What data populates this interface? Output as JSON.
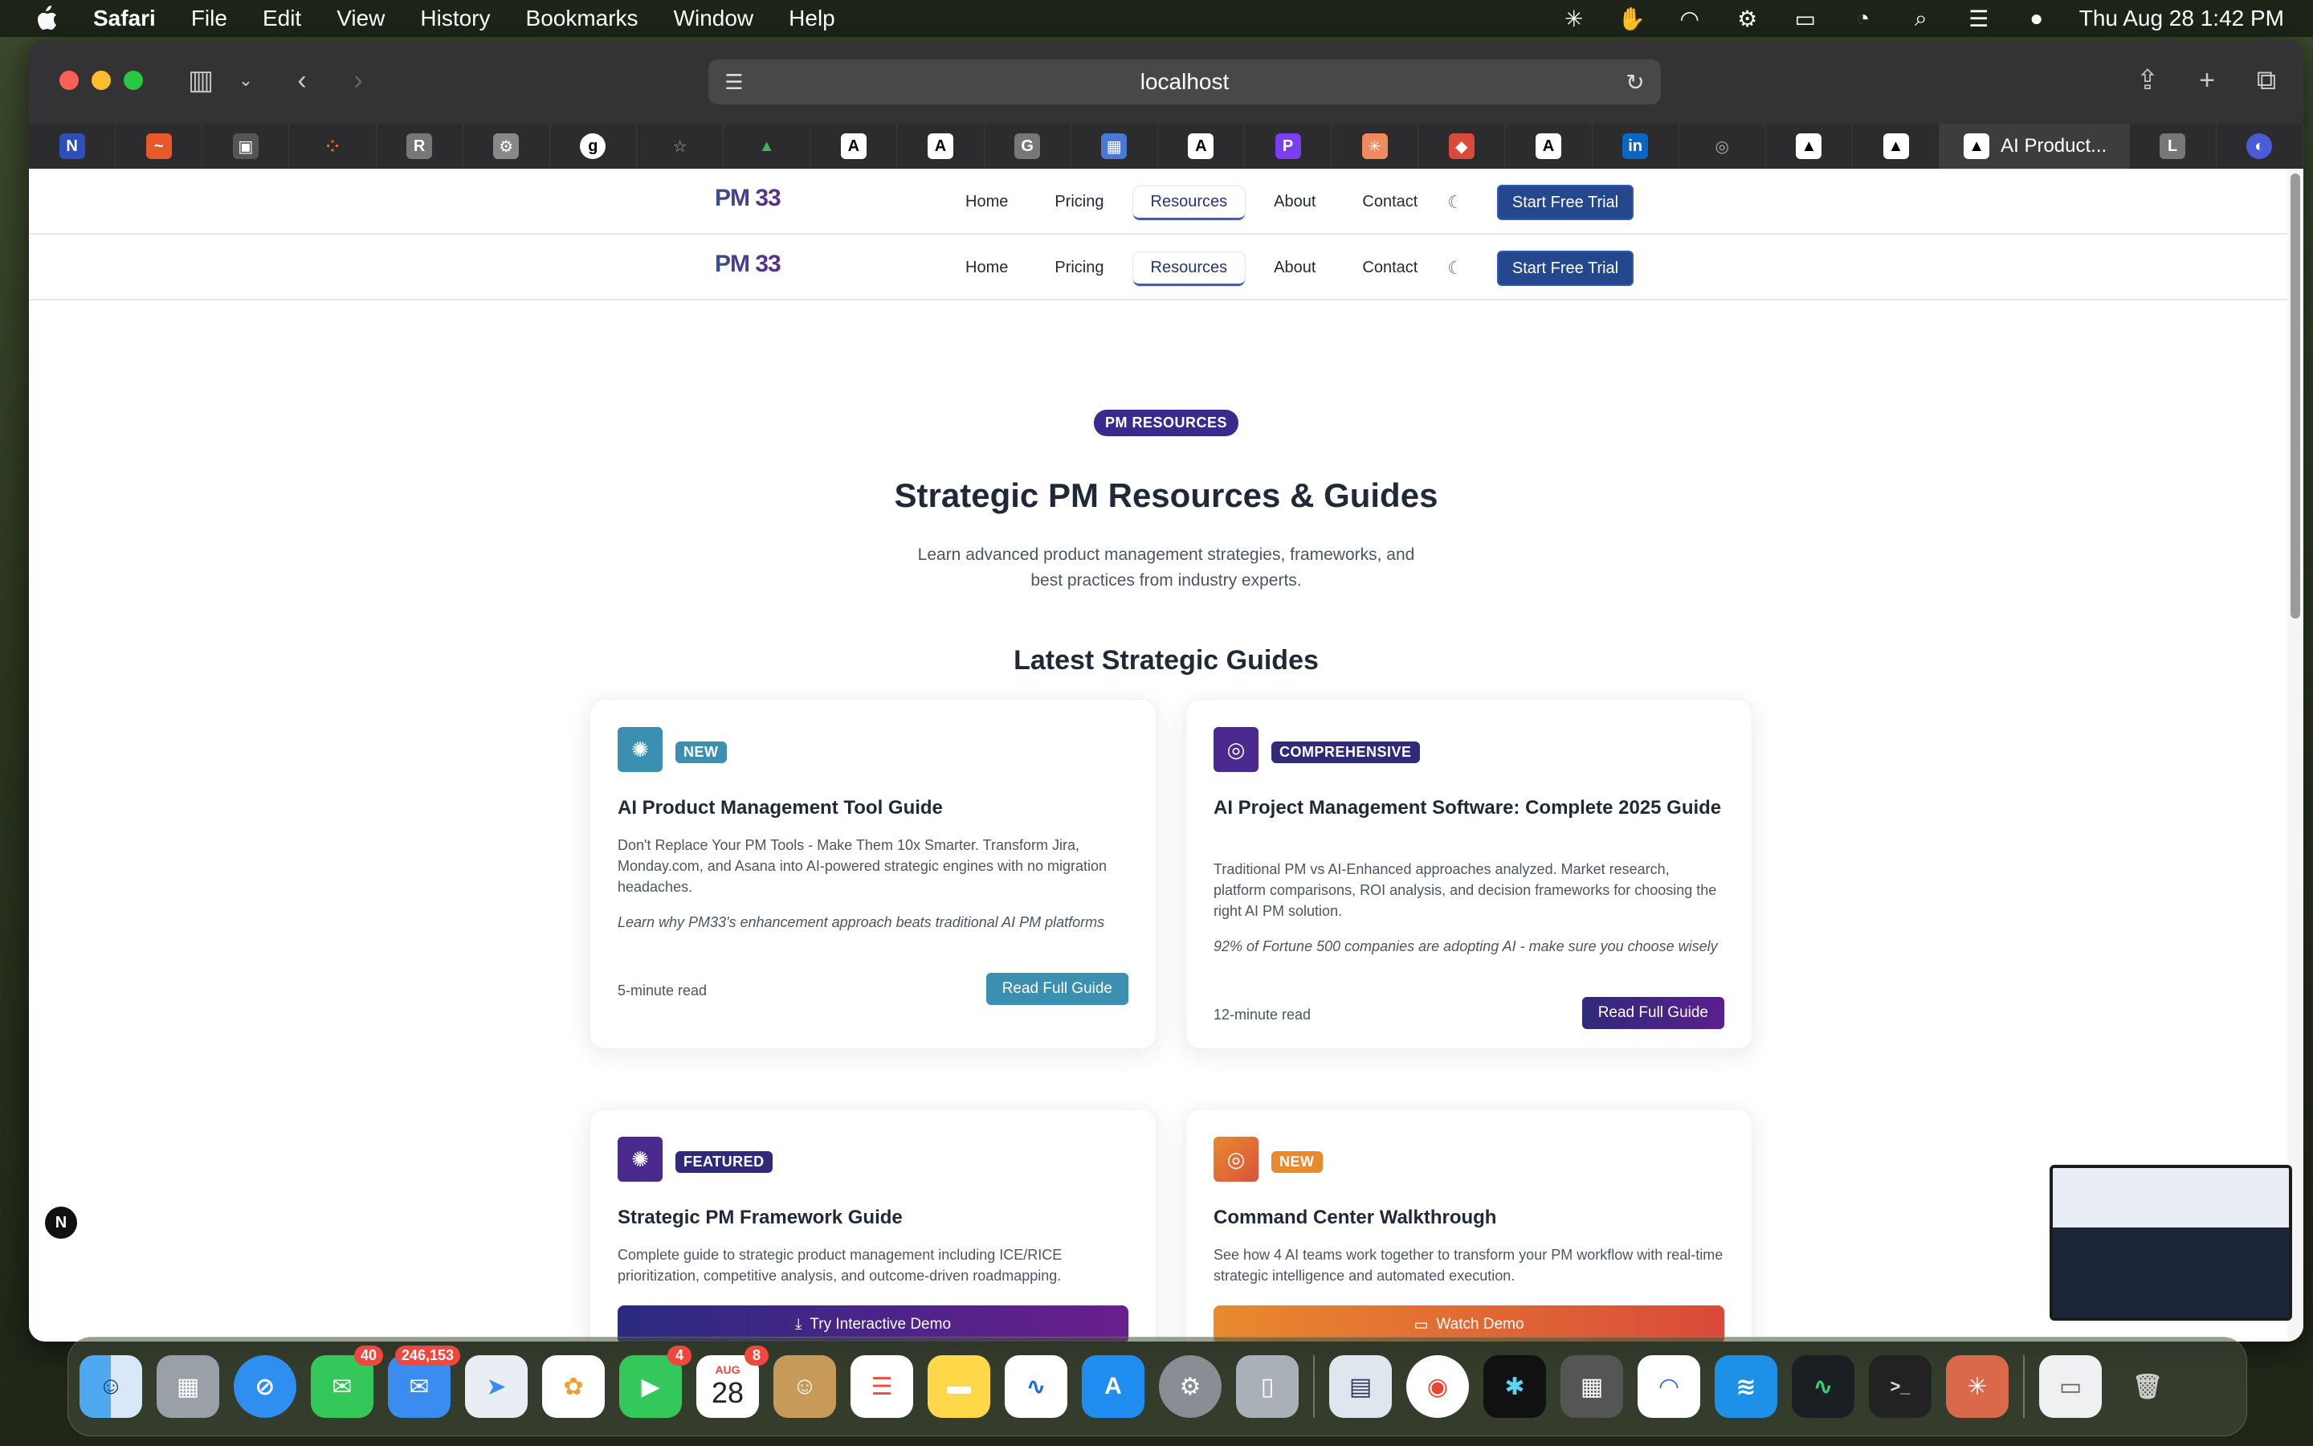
{
  "menubar": {
    "app_name": "Safari",
    "items": [
      "File",
      "Edit",
      "View",
      "History",
      "Bookmarks",
      "Window",
      "Help"
    ],
    "clock": "Thu Aug 28  1:42 PM"
  },
  "browser": {
    "url": "localhost",
    "active_tab_title": "AI Product..."
  },
  "site": {
    "logo": "PM 33",
    "nav": [
      "Home",
      "Pricing",
      "Resources",
      "About",
      "Contact"
    ],
    "active_nav": "Resources",
    "cta": "Start Free Trial"
  },
  "hero": {
    "badge": "PM RESOURCES",
    "title": "Strategic PM Resources & Guides",
    "subtitle": "Learn advanced product management strategies, frameworks, and best practices from industry experts.",
    "section_title": "Latest Strategic Guides"
  },
  "cards": [
    {
      "badge": "NEW",
      "title": "AI Product Management Tool Guide",
      "desc": "Don't Replace Your PM Tools - Make Them 10x Smarter. Transform Jira, Monday.com, and Asana into AI-powered strategic engines with no migration headaches.",
      "quote": "Learn why PM33's enhancement approach beats traditional AI PM platforms",
      "meta": "5-minute read",
      "button": "Read Full Guide",
      "accent": "#3b8fb0"
    },
    {
      "badge": "COMPREHENSIVE",
      "title": "AI Project Management Software: Complete 2025 Guide",
      "desc": "Traditional PM vs AI-Enhanced approaches analyzed. Market research, platform comparisons, ROI analysis, and decision frameworks for choosing the right AI PM solution.",
      "quote": "92% of Fortune 500 companies are adopting AI - make sure you choose wisely",
      "meta": "12-minute read",
      "button": "Read Full Guide",
      "accent": "#3b2a8e"
    },
    {
      "badge": "FEATURED",
      "title": "Strategic PM Framework Guide",
      "desc": "Complete guide to strategic product management including ICE/RICE prioritization, competitive analysis, and outcome-driven roadmapping.",
      "button": "Try Interactive Demo",
      "accent": "#3b2a8e"
    },
    {
      "badge": "NEW",
      "title": "Command Center Walkthrough",
      "desc": "See how 4 AI teams work together to transform your PM workflow with real-time strategic intelligence and automated execution.",
      "button": "Watch Demo",
      "accent": "#e98a2e"
    }
  ],
  "dock": {
    "badges": {
      "messages": "40",
      "mail": "246,153",
      "facetime": "4",
      "calendar": "8"
    },
    "calendar_month": "AUG",
    "calendar_day": "28"
  },
  "misc": {
    "n_badge": "N"
  }
}
